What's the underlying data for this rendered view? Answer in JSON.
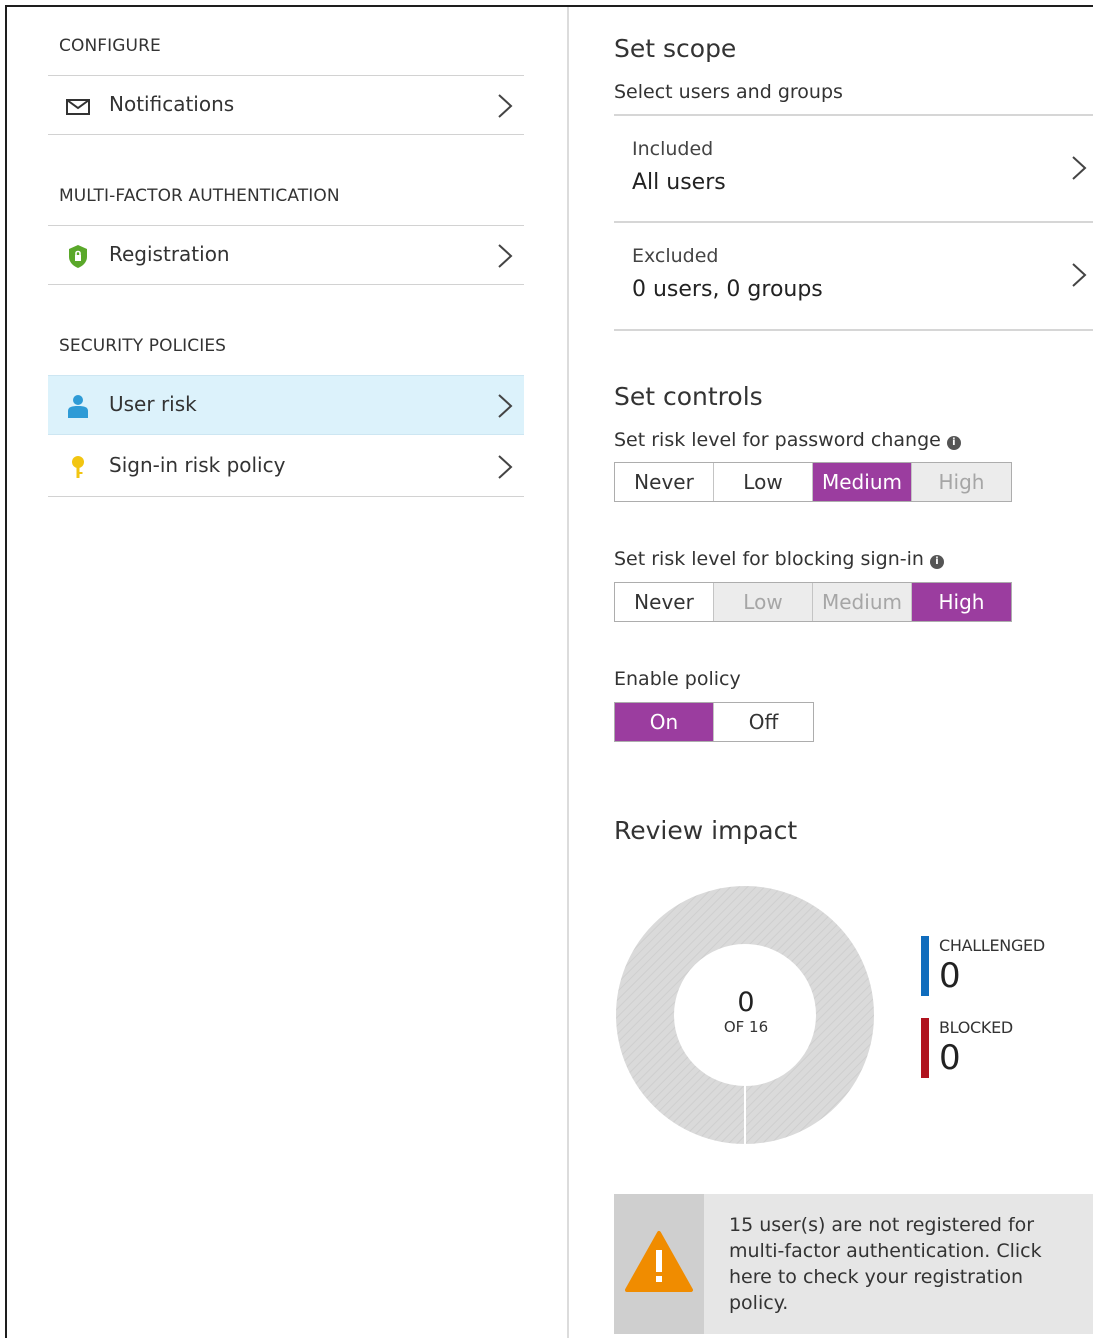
{
  "sidebar": {
    "sections": [
      {
        "heading": "CONFIGURE",
        "items": [
          {
            "label": "Notifications",
            "icon": "envelope-icon"
          }
        ]
      },
      {
        "heading": "MULTI-FACTOR AUTHENTICATION",
        "items": [
          {
            "label": "Registration",
            "icon": "shield-icon"
          }
        ]
      },
      {
        "heading": "SECURITY POLICIES",
        "items": [
          {
            "label": "User risk",
            "icon": "user-icon",
            "selected": true
          },
          {
            "label": "Sign-in risk policy",
            "icon": "key-icon"
          }
        ]
      }
    ]
  },
  "scope": {
    "title": "Set scope",
    "subtitle": "Select users and groups",
    "included": {
      "label": "Included",
      "value": "All users"
    },
    "excluded": {
      "label": "Excluded",
      "value": "0 users, 0 groups"
    }
  },
  "controls": {
    "title": "Set controls",
    "password_change": {
      "label": "Set risk level for password change",
      "options": [
        "Never",
        "Low",
        "Medium",
        "High"
      ],
      "selected": "Medium"
    },
    "blocking_signin": {
      "label": "Set risk level for blocking sign-in",
      "options": [
        "Never",
        "Low",
        "Medium",
        "High"
      ],
      "selected": "High"
    },
    "enable_policy": {
      "label": "Enable policy",
      "options": [
        "On",
        "Off"
      ],
      "selected": "On"
    }
  },
  "impact": {
    "title": "Review impact",
    "center_value": "0",
    "center_sub": "OF 16",
    "challenged": {
      "label": "CHALLENGED",
      "value": "0",
      "color": "#0f6cbd"
    },
    "blocked": {
      "label": "BLOCKED",
      "value": "0",
      "color": "#b0131e"
    }
  },
  "warning": {
    "text": "15 user(s) are not registered for multi-factor authentication. Click here to check your registration policy.",
    "icon": "warning-icon",
    "color": "#f08c00"
  },
  "colors": {
    "accent": "#9b3d9f",
    "selected_row": "#dcf2fb"
  }
}
